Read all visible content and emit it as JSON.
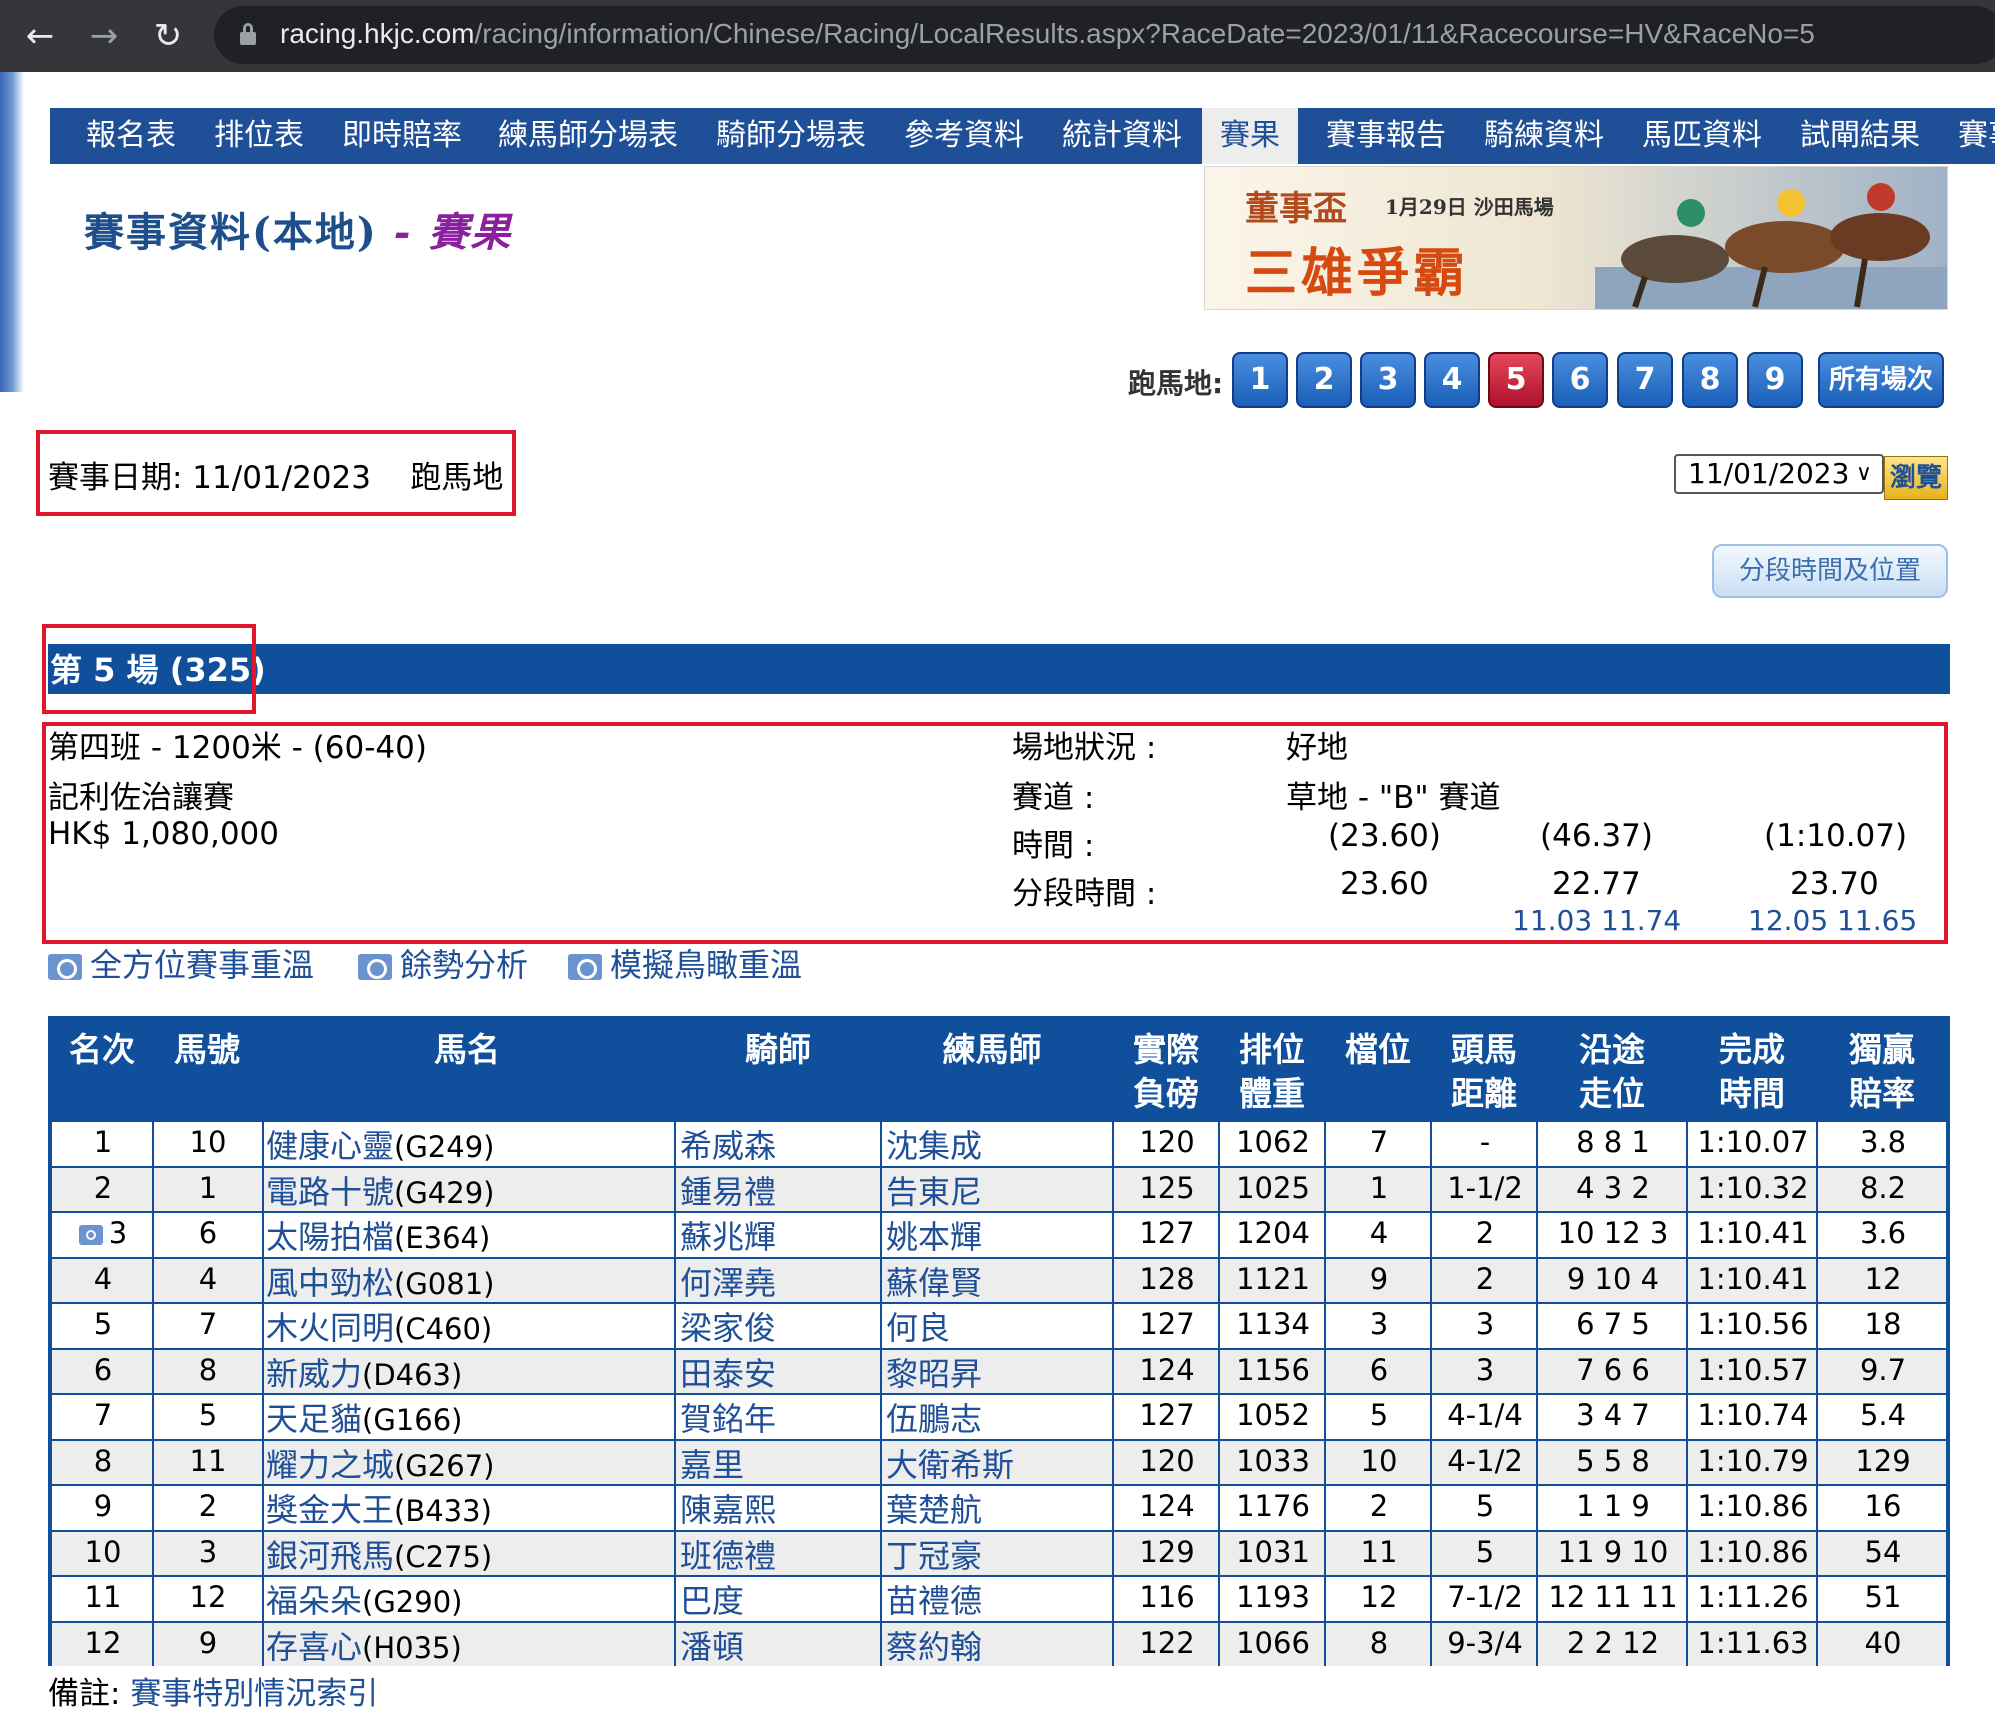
{
  "browser": {
    "url_host": "racing.hkjc.com",
    "url_path": "/racing/information/Chinese/Racing/LocalResults.aspx?RaceDate=2023/01/11&Racecourse=HV&RaceNo=5",
    "back_icon": "←",
    "forward_icon": "→",
    "reload_icon": "↻"
  },
  "nav": {
    "items": [
      "報名表",
      "排位表",
      "即時賠率",
      "練馬師分場表",
      "騎師分場表",
      "參考資料",
      "統計資料",
      "賽果",
      "賽事報告",
      "騎練資料",
      "馬匹資料",
      "試閘結果",
      "賽事"
    ],
    "active": "賽果"
  },
  "page_title": {
    "main": "賽事資料(本地)",
    "sep": " - ",
    "sub": "賽果"
  },
  "banner": {
    "cup": "董事盃",
    "date_venue": "1月29日 沙田馬場",
    "headline": "三雄爭霸"
  },
  "race_selector": {
    "label": "跑馬地:",
    "numbers": [
      "1",
      "2",
      "3",
      "4",
      "5",
      "6",
      "7",
      "8",
      "9"
    ],
    "active": "5",
    "all_label": "所有場次"
  },
  "meeting": {
    "text": "賽事日期: 11/01/2023    跑馬地",
    "selected_date": "11/01/2023",
    "browse_label": "瀏覽"
  },
  "sectional_button": "分段時間及位置",
  "race": {
    "title": "第 5 場 (325)",
    "class_distance": "第四班 - 1200米 - (60-40)",
    "name": "記利佐治讓賽",
    "prize": "HK$ 1,080,000",
    "going_label": "場地狀況 :",
    "going": "好地",
    "course_label": "賽道 :",
    "course": "草地 - \"B\" 賽道",
    "time_label": "時間 :",
    "times": [
      "(23.60)",
      "(46.37)",
      "(1:10.07)"
    ],
    "sectional_label": "分段時間 :",
    "sectionals": [
      "23.60",
      "22.77",
      "23.70"
    ],
    "sub_sectionals": [
      "11.03  11.74",
      "12.05  11.65"
    ]
  },
  "replay_links": [
    "全方位賽事重溫",
    "餘勢分析",
    "模擬鳥瞰重溫"
  ],
  "table": {
    "headers": [
      "名次",
      "馬號",
      "馬名",
      "騎師",
      "練馬師",
      "實際\n負磅",
      "排位\n體重",
      "檔位",
      "頭馬\n距離",
      "沿途\n走位",
      "完成\n時間",
      "獨贏\n賠率"
    ],
    "rows": [
      {
        "place": "1",
        "no": "10",
        "horse": "健康心靈",
        "code": "(G249)",
        "jockey": "希威森",
        "trainer": "沈集成",
        "wt": "120",
        "dwt": "1062",
        "draw": "7",
        "lbw": "-",
        "pos": "8   8   1",
        "time": "1:10.07",
        "odds": "3.8"
      },
      {
        "place": "2",
        "no": "1",
        "horse": "電路十號",
        "code": "(G429)",
        "jockey": "鍾易禮",
        "trainer": "告東尼",
        "wt": "125",
        "dwt": "1025",
        "draw": "1",
        "lbw": "1-1/2",
        "pos": "4   3   2",
        "time": "1:10.32",
        "odds": "8.2"
      },
      {
        "place": "3",
        "no": "6",
        "horse": "太陽拍檔",
        "code": "(E364)",
        "jockey": "蘇兆輝",
        "trainer": "姚本輝",
        "wt": "127",
        "dwt": "1204",
        "draw": "4",
        "lbw": "2",
        "pos": "10 12  3",
        "time": "1:10.41",
        "odds": "3.6"
      },
      {
        "place": "4",
        "no": "4",
        "horse": "風中勁松",
        "code": "(G081)",
        "jockey": "何澤堯",
        "trainer": "蘇偉賢",
        "wt": "128",
        "dwt": "1121",
        "draw": "9",
        "lbw": "2",
        "pos": "9  10  4",
        "time": "1:10.41",
        "odds": "12"
      },
      {
        "place": "5",
        "no": "7",
        "horse": "木火同明",
        "code": "(C460)",
        "jockey": "梁家俊",
        "trainer": "何良",
        "wt": "127",
        "dwt": "1134",
        "draw": "3",
        "lbw": "3",
        "pos": "6   7   5",
        "time": "1:10.56",
        "odds": "18"
      },
      {
        "place": "6",
        "no": "8",
        "horse": "新威力",
        "code": "(D463)",
        "jockey": "田泰安",
        "trainer": "黎昭昇",
        "wt": "124",
        "dwt": "1156",
        "draw": "6",
        "lbw": "3",
        "pos": "7   6   6",
        "time": "1:10.57",
        "odds": "9.7"
      },
      {
        "place": "7",
        "no": "5",
        "horse": "天足貓",
        "code": "(G166)",
        "jockey": "賀銘年",
        "trainer": "伍鵬志",
        "wt": "127",
        "dwt": "1052",
        "draw": "5",
        "lbw": "4-1/4",
        "pos": "3   4   7",
        "time": "1:10.74",
        "odds": "5.4"
      },
      {
        "place": "8",
        "no": "11",
        "horse": "耀力之城",
        "code": "(G267)",
        "jockey": "嘉里",
        "trainer": "大衛希斯",
        "wt": "120",
        "dwt": "1033",
        "draw": "10",
        "lbw": "4-1/2",
        "pos": "5   5   8",
        "time": "1:10.79",
        "odds": "129"
      },
      {
        "place": "9",
        "no": "2",
        "horse": "獎金大王",
        "code": "(B433)",
        "jockey": "陳嘉熙",
        "trainer": "葉楚航",
        "wt": "124",
        "dwt": "1176",
        "draw": "2",
        "lbw": "5",
        "pos": "1   1   9",
        "time": "1:10.86",
        "odds": "16"
      },
      {
        "place": "10",
        "no": "3",
        "horse": "銀河飛馬",
        "code": "(C275)",
        "jockey": "班德禮",
        "trainer": "丁冠豪",
        "wt": "129",
        "dwt": "1031",
        "draw": "11",
        "lbw": "5",
        "pos": "11  9  10",
        "time": "1:10.86",
        "odds": "54"
      },
      {
        "place": "11",
        "no": "12",
        "horse": "福朵朵",
        "code": "(G290)",
        "jockey": "巴度",
        "trainer": "苗禮德",
        "wt": "116",
        "dwt": "1193",
        "draw": "12",
        "lbw": "7-1/2",
        "pos": "12 11 11",
        "time": "1:11.26",
        "odds": "51"
      },
      {
        "place": "12",
        "no": "9",
        "horse": "存喜心",
        "code": "(H035)",
        "jockey": "潘頓",
        "trainer": "蔡約翰",
        "wt": "122",
        "dwt": "1066",
        "draw": "8",
        "lbw": "9-3/4",
        "pos": "2   2  12",
        "time": "1:11.63",
        "odds": "40"
      }
    ]
  },
  "remarks": {
    "label": "備註: ",
    "link": "賽事特別情況索引"
  },
  "colors": {
    "nav_bg": "#1f4f97",
    "table_border": "#0f4f9c",
    "highlight_red": "#e0162b",
    "link_blue": "#1f4f97"
  }
}
